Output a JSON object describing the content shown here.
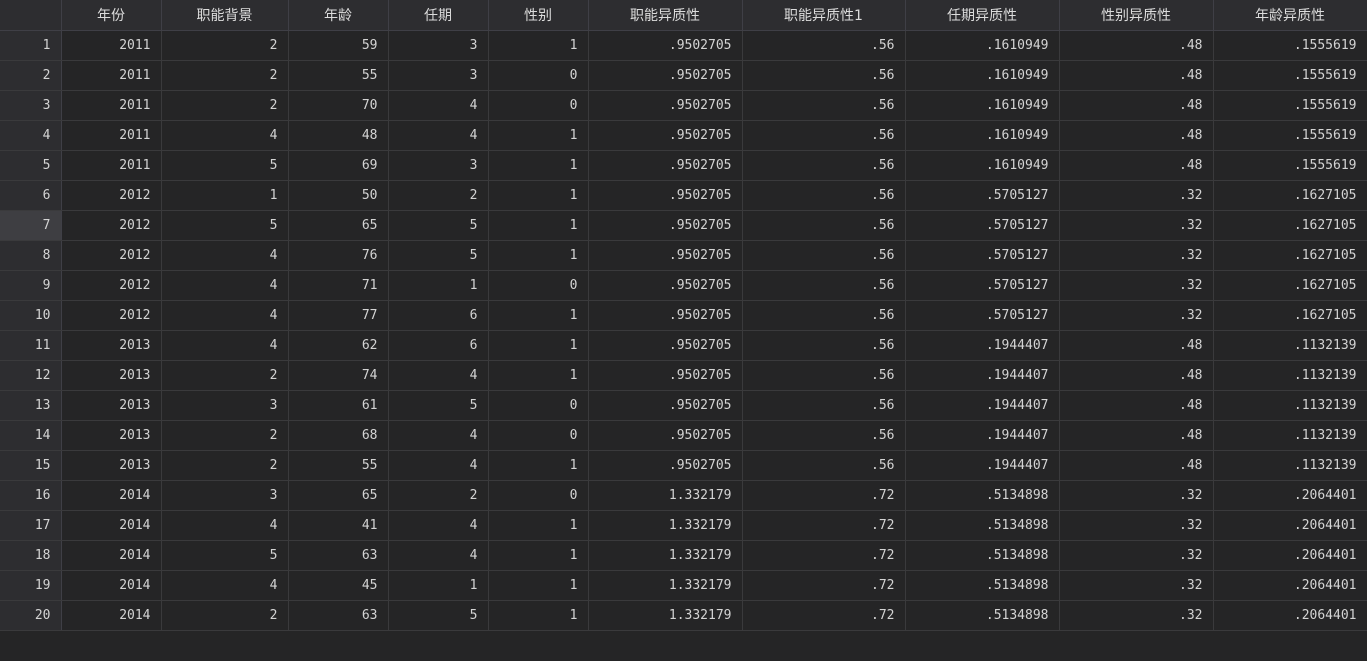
{
  "columns": [
    "年份",
    "职能背景",
    "年龄",
    "任期",
    "性别",
    "职能异质性",
    "职能异质性1",
    "任期异质性",
    "性别异质性",
    "年龄异质性"
  ],
  "rows": [
    [
      "1",
      "2011",
      "2",
      "59",
      "3",
      "1",
      ".9502705",
      ".56",
      ".1610949",
      ".48",
      ".1555619"
    ],
    [
      "2",
      "2011",
      "2",
      "55",
      "3",
      "0",
      ".9502705",
      ".56",
      ".1610949",
      ".48",
      ".1555619"
    ],
    [
      "3",
      "2011",
      "2",
      "70",
      "4",
      "0",
      ".9502705",
      ".56",
      ".1610949",
      ".48",
      ".1555619"
    ],
    [
      "4",
      "2011",
      "4",
      "48",
      "4",
      "1",
      ".9502705",
      ".56",
      ".1610949",
      ".48",
      ".1555619"
    ],
    [
      "5",
      "2011",
      "5",
      "69",
      "3",
      "1",
      ".9502705",
      ".56",
      ".1610949",
      ".48",
      ".1555619"
    ],
    [
      "6",
      "2012",
      "1",
      "50",
      "2",
      "1",
      ".9502705",
      ".56",
      ".5705127",
      ".32",
      ".1627105"
    ],
    [
      "7",
      "2012",
      "5",
      "65",
      "5",
      "1",
      ".9502705",
      ".56",
      ".5705127",
      ".32",
      ".1627105"
    ],
    [
      "8",
      "2012",
      "4",
      "76",
      "5",
      "1",
      ".9502705",
      ".56",
      ".5705127",
      ".32",
      ".1627105"
    ],
    [
      "9",
      "2012",
      "4",
      "71",
      "1",
      "0",
      ".9502705",
      ".56",
      ".5705127",
      ".32",
      ".1627105"
    ],
    [
      "10",
      "2012",
      "4",
      "77",
      "6",
      "1",
      ".9502705",
      ".56",
      ".5705127",
      ".32",
      ".1627105"
    ],
    [
      "11",
      "2013",
      "4",
      "62",
      "6",
      "1",
      ".9502705",
      ".56",
      ".1944407",
      ".48",
      ".1132139"
    ],
    [
      "12",
      "2013",
      "2",
      "74",
      "4",
      "1",
      ".9502705",
      ".56",
      ".1944407",
      ".48",
      ".1132139"
    ],
    [
      "13",
      "2013",
      "3",
      "61",
      "5",
      "0",
      ".9502705",
      ".56",
      ".1944407",
      ".48",
      ".1132139"
    ],
    [
      "14",
      "2013",
      "2",
      "68",
      "4",
      "0",
      ".9502705",
      ".56",
      ".1944407",
      ".48",
      ".1132139"
    ],
    [
      "15",
      "2013",
      "2",
      "55",
      "4",
      "1",
      ".9502705",
      ".56",
      ".1944407",
      ".48",
      ".1132139"
    ],
    [
      "16",
      "2014",
      "3",
      "65",
      "2",
      "0",
      "1.332179",
      ".72",
      ".5134898",
      ".32",
      ".2064401"
    ],
    [
      "17",
      "2014",
      "4",
      "41",
      "4",
      "1",
      "1.332179",
      ".72",
      ".5134898",
      ".32",
      ".2064401"
    ],
    [
      "18",
      "2014",
      "5",
      "63",
      "4",
      "1",
      "1.332179",
      ".72",
      ".5134898",
      ".32",
      ".2064401"
    ],
    [
      "19",
      "2014",
      "4",
      "45",
      "1",
      "1",
      "1.332179",
      ".72",
      ".5134898",
      ".32",
      ".2064401"
    ],
    [
      "20",
      "2014",
      "2",
      "63",
      "5",
      "1",
      "1.332179",
      ".72",
      ".5134898",
      ".32",
      ".2064401"
    ]
  ],
  "active_row": "7"
}
